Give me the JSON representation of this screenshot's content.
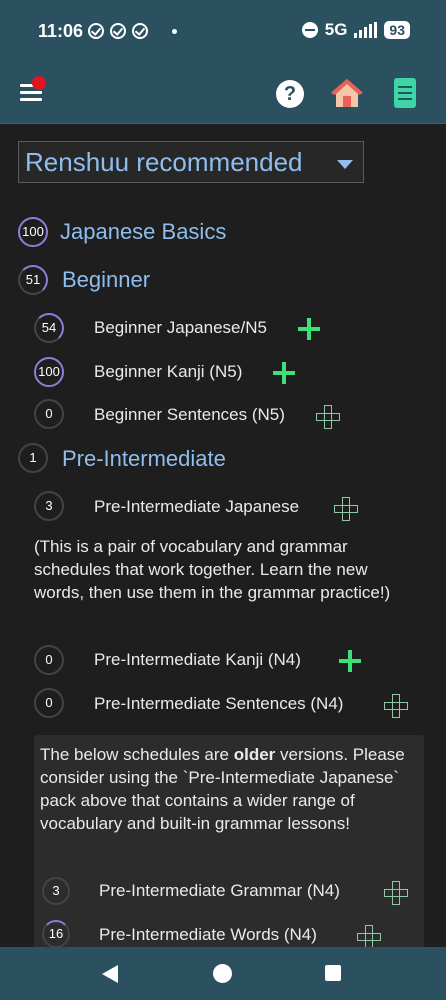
{
  "status_bar": {
    "time": "11:06",
    "network": "5G",
    "battery": "93"
  },
  "app_bar": {
    "help_label": "?"
  },
  "selector": {
    "selected": "Renshuu recommended"
  },
  "categories": [
    {
      "title": "Japanese Basics",
      "progress": "100"
    },
    {
      "title": "Beginner",
      "progress": "51"
    },
    {
      "title": "Pre-Intermediate",
      "progress": "1"
    }
  ],
  "beginner_items": [
    {
      "title": "Beginner Japanese/N5",
      "progress": "54",
      "added": false
    },
    {
      "title": "Beginner Kanji (N5)",
      "progress": "100",
      "added": false
    },
    {
      "title": "Beginner Sentences (N5)",
      "progress": "0",
      "added": true
    }
  ],
  "preint_items": [
    {
      "title": "Pre-Intermediate Japanese",
      "progress": "3"
    },
    {
      "title": "Pre-Intermediate Kanji (N4)",
      "progress": "0"
    },
    {
      "title": "Pre-Intermediate Sentences (N4)",
      "progress": "0"
    }
  ],
  "preint_note": "(This is a pair of vocabulary and grammar schedules that work together. Learn the new words, then use them in the grammar practice!)",
  "older_notice": {
    "before": "The below schedules are ",
    "bold": "older",
    "after": " versions. Please consider using the `Pre-Intermediate Japanese` pack above that contains a wider range of vocabulary and built-in grammar lessons!"
  },
  "older_items": [
    {
      "title": "Pre-Intermediate Grammar (N4)",
      "progress": "3"
    },
    {
      "title": "Pre-Intermediate Words (N4)",
      "progress": "16"
    }
  ]
}
